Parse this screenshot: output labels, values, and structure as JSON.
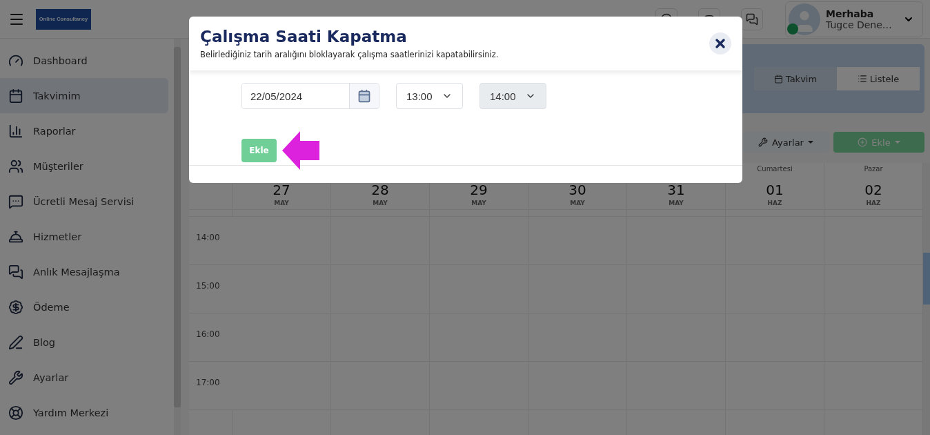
{
  "header": {
    "logo_text": "Online Consultancy",
    "user": {
      "greeting": "Merhaba",
      "name": "Tugce Dene…",
      "online": true
    }
  },
  "sidebar": {
    "items": [
      {
        "label": "Dashboard",
        "selected": false
      },
      {
        "label": "Takvimim",
        "selected": true
      },
      {
        "label": "Raporlar",
        "selected": false
      },
      {
        "label": "Müşteriler",
        "selected": false
      },
      {
        "label": "Ücretli Mesaj Servisi",
        "selected": false
      },
      {
        "label": "Hizmetler",
        "selected": false
      },
      {
        "label": "Anlık Mesajlaşma",
        "selected": false
      },
      {
        "label": "Ödeme",
        "selected": false
      },
      {
        "label": "Blog",
        "selected": false
      },
      {
        "label": "Ayarlar",
        "selected": false
      },
      {
        "label": "Yardım Merkezi",
        "selected": false
      }
    ]
  },
  "view_toggle": [
    {
      "label": "Takvim",
      "selected": true
    },
    {
      "label": "Listele",
      "selected": false
    }
  ],
  "toolbar": {
    "settings_button": "Ayarlar",
    "add_button": "Ekle"
  },
  "calendar": {
    "days": [
      {
        "date": "27",
        "month": "MAY"
      },
      {
        "date": "28",
        "month": "MAY"
      },
      {
        "date": "29",
        "month": "MAY"
      },
      {
        "date": "30",
        "month": "MAY"
      },
      {
        "date": "31",
        "month": "MAY"
      },
      {
        "weekday": "Cumartesi",
        "date": "01",
        "month": "HAZ"
      },
      {
        "weekday": "Pazar",
        "date": "02",
        "month": "HAZ"
      }
    ],
    "times": [
      "14:00",
      "15:00",
      "16:00",
      "17:00"
    ]
  },
  "modal": {
    "title": "Çalışma Saati Kapatma",
    "subtitle": "Belirlediğiniz tarih aralığını bloklayarak çalışma saatlerinizi kapatabilirsiniz.",
    "date": "22/05/2024",
    "start_time": {
      "value": "13:00",
      "disabled": false
    },
    "end_time": {
      "value": "14:00",
      "disabled": true
    },
    "submit": "Ekle"
  }
}
